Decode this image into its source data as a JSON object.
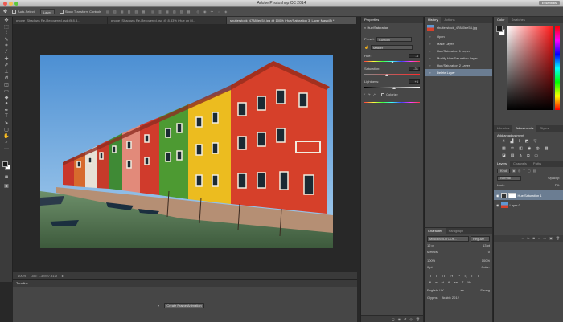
{
  "window": {
    "title": "Adobe Photoshop CC 2014",
    "workspace": "Essentials",
    "traffic_colors": [
      "#ee5a52",
      "#f5bf4f",
      "#5fc83d"
    ]
  },
  "options": {
    "auto_select": "Auto-Select:",
    "layer": "Layer",
    "show_transform": "Show Transform Controls"
  },
  "tabs": [
    {
      "label": "phone_Shadows Re-Recovered.psd @ 8.3...",
      "active": false
    },
    {
      "label": "phone_Shadows Re-Recovered.psd @ 8.33% (Hue on M...",
      "active": false
    },
    {
      "label": "shutterstock_47880ee54.jpg @ 100% (Hue/Saturation 3, Layer Mask/8) *",
      "active": true
    }
  ],
  "status": {
    "zoom": "100%",
    "doc": "Doc: 1.37M/7.81M"
  },
  "timeline": {
    "title": "Timeline",
    "create_button": "Create Frame Animation"
  },
  "properties": {
    "title": "Properties",
    "subtitle": "Hue/Saturation",
    "preset_label": "Preset:",
    "preset_value": "Custom",
    "channel_value": "Master",
    "hue_label": "Hue:",
    "hue_value": "-6",
    "saturation_label": "Saturation:",
    "saturation_value": "-31",
    "lightness_label": "Lightness:",
    "lightness_value": "+6",
    "colorize": "Colorize"
  },
  "history": {
    "tabs": [
      "History",
      "Actions"
    ],
    "snapshot": "shutterstock_47880ee54.jpg",
    "items": [
      "Open",
      "Make Layer",
      "Hue/Saturation 1 Layer",
      "Modify Hue/Saturation Layer",
      "Hue/Saturation 2 Layer",
      "Delete Layer"
    ],
    "selected_index": 5
  },
  "color": {
    "tabs": [
      "Color",
      "Swatches"
    ]
  },
  "adjustments": {
    "tabs": [
      "Libraries",
      "Adjustments",
      "Styles"
    ],
    "heading": "Add an adjustment"
  },
  "layers": {
    "tabs": [
      "Layers",
      "Channels",
      "Paths"
    ],
    "kind": "Kind",
    "mode": "Normal",
    "opacity_label": "Opacity:",
    "lock_label": "Lock:",
    "fill_label": "Fill:",
    "rows": [
      {
        "name": "Hue/Saturation 1",
        "selected": true
      },
      {
        "name": "Layer 0",
        "selected": false
      }
    ]
  },
  "character": {
    "tabs": [
      "Character",
      "Paragraph"
    ],
    "font": "MinionStd-ITCOs...",
    "style": "Regular",
    "size": "12 pt",
    "leading": "13 pt",
    "tracking": "Metrics",
    "kerning": "0",
    "vscale": "100%",
    "hscale": "100%",
    "baseline": "0 pt",
    "color_label": "Color:",
    "language": "English: UK",
    "aa_label": "aa",
    "aa": "Strong",
    "glyphs_tab": "Glyphs",
    "glyphs_value": "Arabic 2012"
  },
  "colors": {
    "swatch_fg": "#1a1a1a",
    "swatch_bg": "#ffffff",
    "selection": "#6b7d92",
    "sky": "#5d97d1"
  }
}
